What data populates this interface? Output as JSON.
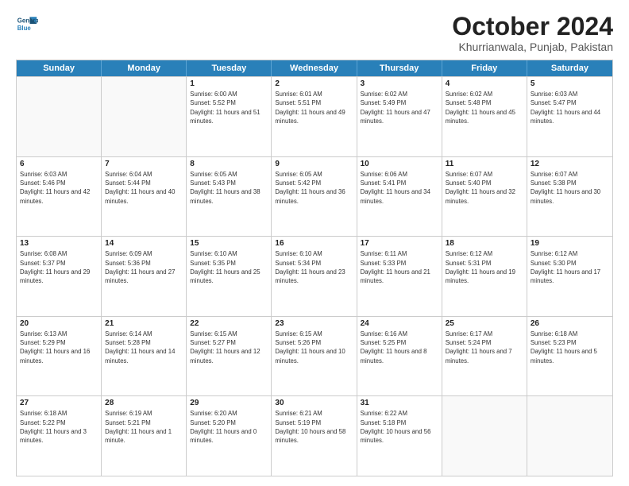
{
  "header": {
    "logo_line1": "General",
    "logo_line2": "Blue",
    "month_title": "October 2024",
    "subtitle": "Khurrianwala, Punjab, Pakistan"
  },
  "weekdays": [
    "Sunday",
    "Monday",
    "Tuesday",
    "Wednesday",
    "Thursday",
    "Friday",
    "Saturday"
  ],
  "rows": [
    [
      {
        "day": "",
        "sunrise": "",
        "sunset": "",
        "daylight": ""
      },
      {
        "day": "",
        "sunrise": "",
        "sunset": "",
        "daylight": ""
      },
      {
        "day": "1",
        "sunrise": "Sunrise: 6:00 AM",
        "sunset": "Sunset: 5:52 PM",
        "daylight": "Daylight: 11 hours and 51 minutes."
      },
      {
        "day": "2",
        "sunrise": "Sunrise: 6:01 AM",
        "sunset": "Sunset: 5:51 PM",
        "daylight": "Daylight: 11 hours and 49 minutes."
      },
      {
        "day": "3",
        "sunrise": "Sunrise: 6:02 AM",
        "sunset": "Sunset: 5:49 PM",
        "daylight": "Daylight: 11 hours and 47 minutes."
      },
      {
        "day": "4",
        "sunrise": "Sunrise: 6:02 AM",
        "sunset": "Sunset: 5:48 PM",
        "daylight": "Daylight: 11 hours and 45 minutes."
      },
      {
        "day": "5",
        "sunrise": "Sunrise: 6:03 AM",
        "sunset": "Sunset: 5:47 PM",
        "daylight": "Daylight: 11 hours and 44 minutes."
      }
    ],
    [
      {
        "day": "6",
        "sunrise": "Sunrise: 6:03 AM",
        "sunset": "Sunset: 5:46 PM",
        "daylight": "Daylight: 11 hours and 42 minutes."
      },
      {
        "day": "7",
        "sunrise": "Sunrise: 6:04 AM",
        "sunset": "Sunset: 5:44 PM",
        "daylight": "Daylight: 11 hours and 40 minutes."
      },
      {
        "day": "8",
        "sunrise": "Sunrise: 6:05 AM",
        "sunset": "Sunset: 5:43 PM",
        "daylight": "Daylight: 11 hours and 38 minutes."
      },
      {
        "day": "9",
        "sunrise": "Sunrise: 6:05 AM",
        "sunset": "Sunset: 5:42 PM",
        "daylight": "Daylight: 11 hours and 36 minutes."
      },
      {
        "day": "10",
        "sunrise": "Sunrise: 6:06 AM",
        "sunset": "Sunset: 5:41 PM",
        "daylight": "Daylight: 11 hours and 34 minutes."
      },
      {
        "day": "11",
        "sunrise": "Sunrise: 6:07 AM",
        "sunset": "Sunset: 5:40 PM",
        "daylight": "Daylight: 11 hours and 32 minutes."
      },
      {
        "day": "12",
        "sunrise": "Sunrise: 6:07 AM",
        "sunset": "Sunset: 5:38 PM",
        "daylight": "Daylight: 11 hours and 30 minutes."
      }
    ],
    [
      {
        "day": "13",
        "sunrise": "Sunrise: 6:08 AM",
        "sunset": "Sunset: 5:37 PM",
        "daylight": "Daylight: 11 hours and 29 minutes."
      },
      {
        "day": "14",
        "sunrise": "Sunrise: 6:09 AM",
        "sunset": "Sunset: 5:36 PM",
        "daylight": "Daylight: 11 hours and 27 minutes."
      },
      {
        "day": "15",
        "sunrise": "Sunrise: 6:10 AM",
        "sunset": "Sunset: 5:35 PM",
        "daylight": "Daylight: 11 hours and 25 minutes."
      },
      {
        "day": "16",
        "sunrise": "Sunrise: 6:10 AM",
        "sunset": "Sunset: 5:34 PM",
        "daylight": "Daylight: 11 hours and 23 minutes."
      },
      {
        "day": "17",
        "sunrise": "Sunrise: 6:11 AM",
        "sunset": "Sunset: 5:33 PM",
        "daylight": "Daylight: 11 hours and 21 minutes."
      },
      {
        "day": "18",
        "sunrise": "Sunrise: 6:12 AM",
        "sunset": "Sunset: 5:31 PM",
        "daylight": "Daylight: 11 hours and 19 minutes."
      },
      {
        "day": "19",
        "sunrise": "Sunrise: 6:12 AM",
        "sunset": "Sunset: 5:30 PM",
        "daylight": "Daylight: 11 hours and 17 minutes."
      }
    ],
    [
      {
        "day": "20",
        "sunrise": "Sunrise: 6:13 AM",
        "sunset": "Sunset: 5:29 PM",
        "daylight": "Daylight: 11 hours and 16 minutes."
      },
      {
        "day": "21",
        "sunrise": "Sunrise: 6:14 AM",
        "sunset": "Sunset: 5:28 PM",
        "daylight": "Daylight: 11 hours and 14 minutes."
      },
      {
        "day": "22",
        "sunrise": "Sunrise: 6:15 AM",
        "sunset": "Sunset: 5:27 PM",
        "daylight": "Daylight: 11 hours and 12 minutes."
      },
      {
        "day": "23",
        "sunrise": "Sunrise: 6:15 AM",
        "sunset": "Sunset: 5:26 PM",
        "daylight": "Daylight: 11 hours and 10 minutes."
      },
      {
        "day": "24",
        "sunrise": "Sunrise: 6:16 AM",
        "sunset": "Sunset: 5:25 PM",
        "daylight": "Daylight: 11 hours and 8 minutes."
      },
      {
        "day": "25",
        "sunrise": "Sunrise: 6:17 AM",
        "sunset": "Sunset: 5:24 PM",
        "daylight": "Daylight: 11 hours and 7 minutes."
      },
      {
        "day": "26",
        "sunrise": "Sunrise: 6:18 AM",
        "sunset": "Sunset: 5:23 PM",
        "daylight": "Daylight: 11 hours and 5 minutes."
      }
    ],
    [
      {
        "day": "27",
        "sunrise": "Sunrise: 6:18 AM",
        "sunset": "Sunset: 5:22 PM",
        "daylight": "Daylight: 11 hours and 3 minutes."
      },
      {
        "day": "28",
        "sunrise": "Sunrise: 6:19 AM",
        "sunset": "Sunset: 5:21 PM",
        "daylight": "Daylight: 11 hours and 1 minute."
      },
      {
        "day": "29",
        "sunrise": "Sunrise: 6:20 AM",
        "sunset": "Sunset: 5:20 PM",
        "daylight": "Daylight: 11 hours and 0 minutes."
      },
      {
        "day": "30",
        "sunrise": "Sunrise: 6:21 AM",
        "sunset": "Sunset: 5:19 PM",
        "daylight": "Daylight: 10 hours and 58 minutes."
      },
      {
        "day": "31",
        "sunrise": "Sunrise: 6:22 AM",
        "sunset": "Sunset: 5:18 PM",
        "daylight": "Daylight: 10 hours and 56 minutes."
      },
      {
        "day": "",
        "sunrise": "",
        "sunset": "",
        "daylight": ""
      },
      {
        "day": "",
        "sunrise": "",
        "sunset": "",
        "daylight": ""
      }
    ]
  ]
}
